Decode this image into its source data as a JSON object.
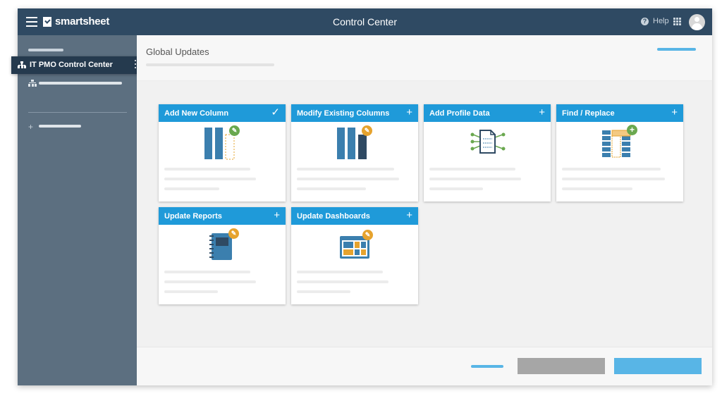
{
  "app": {
    "brand": "smartsheet",
    "title": "Control Center",
    "help_label": "Help"
  },
  "sidebar": {
    "active_item": "IT PMO Control Center"
  },
  "main": {
    "page_title": "Global Updates"
  },
  "cards": [
    {
      "title": "Add New Column",
      "action": "✓",
      "icon": "columns-icon",
      "badge": "pencil-icon",
      "badge_color": "#6aa84f"
    },
    {
      "title": "Modify Existing Columns",
      "action": "+",
      "icon": "columns-icon",
      "badge": "pencil-icon",
      "badge_color": "#e6a32e"
    },
    {
      "title": "Add Profile Data",
      "action": "+",
      "icon": "document-network-icon",
      "badge": "",
      "badge_color": ""
    },
    {
      "title": "Find / Replace",
      "action": "+",
      "icon": "grid-icon",
      "badge": "plus-icon",
      "badge_color": "#6aa84f"
    },
    {
      "title": "Update Reports",
      "action": "+",
      "icon": "notebook-icon",
      "badge": "pencil-icon",
      "badge_color": "#e6a32e"
    },
    {
      "title": "Update Dashboards",
      "action": "+",
      "icon": "dashboard-icon",
      "badge": "pencil-icon",
      "badge_color": "#e6a32e"
    }
  ],
  "colors": {
    "topbar": "#2f4a63",
    "sidebar": "#5c6f80",
    "card_header": "#1f9ad9",
    "primary_button": "#58b5e6",
    "secondary_button": "#a6a6a6"
  }
}
